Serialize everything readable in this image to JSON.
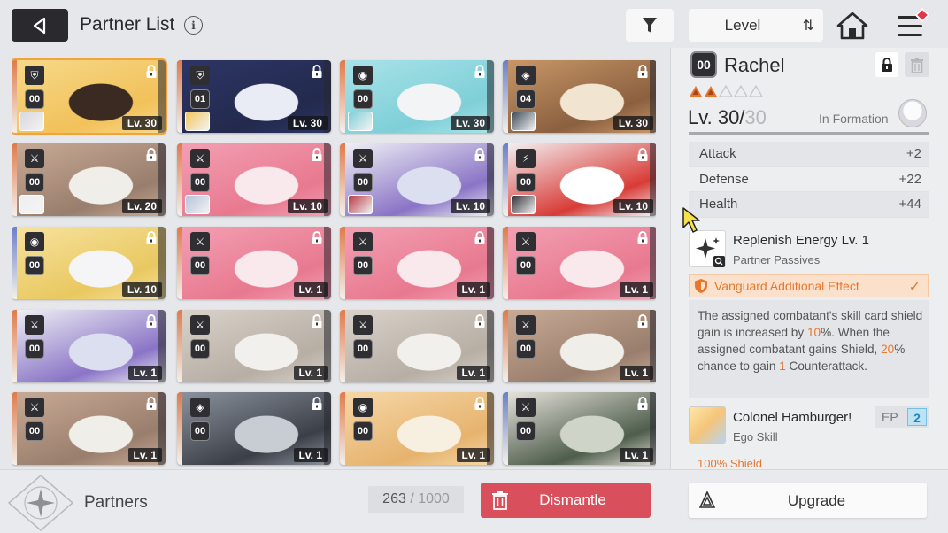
{
  "header": {
    "title": "Partner List",
    "info_icon": "i",
    "sort_label": "Level",
    "sort_order_icon": "⇅"
  },
  "icons": {
    "back": "back-arrow-icon",
    "filter": "filter-icon",
    "home": "home-icon",
    "menu": "hamburger-menu-icon",
    "lock": "lock-icon",
    "trash": "trash-icon"
  },
  "cards": [
    {
      "rank": "00",
      "class": "⛨",
      "level": "Lv. 30",
      "selected": true,
      "art": [
        "#f6d98a",
        "#f2c15a",
        "#3a2a22"
      ],
      "edge": "#e07a4a",
      "mini": "#d8d8de"
    },
    {
      "rank": "01",
      "class": "⛨",
      "level": "Lv. 30",
      "selected": false,
      "art": [
        "#2d3566",
        "#232a4d",
        "#e9ecf4"
      ],
      "edge": "#e07a4a",
      "mini": "#f2c65e"
    },
    {
      "rank": "00",
      "class": "◉",
      "level": "Lv. 30",
      "selected": false,
      "art": [
        "#a9e3e8",
        "#7fcfd8",
        "#f3f4f6"
      ],
      "edge": "#e07a4a",
      "mini": "#7fcfd8"
    },
    {
      "rank": "04",
      "class": "◈",
      "level": "Lv. 30",
      "selected": false,
      "art": [
        "#c99868",
        "#8b6040",
        "#f1e4d0"
      ],
      "edge": "#6a7fc9",
      "mini": "#3e4a58"
    },
    {
      "rank": "00",
      "class": "⚔",
      "level": "Lv. 20",
      "selected": false,
      "art": [
        "#c8ab96",
        "#9a7e6d",
        "#f0eee9"
      ],
      "edge": "#e07a4a",
      "mini": "#efeff1"
    },
    {
      "rank": "00",
      "class": "⚔",
      "level": "Lv. 10",
      "selected": false,
      "art": [
        "#f3a0b4",
        "#e8798f",
        "#f9e9ec"
      ],
      "edge": "#e07a4a",
      "mini": "#b6c3d8"
    },
    {
      "rank": "00",
      "class": "⚔",
      "level": "Lv. 10",
      "selected": false,
      "art": [
        "#f1f2f6",
        "#8a74c6",
        "#dcdff0"
      ],
      "edge": "#e07a4a",
      "mini": "#b83a44"
    },
    {
      "rank": "00",
      "class": "⚡",
      "level": "Lv. 10",
      "selected": false,
      "art": [
        "#f3f3f5",
        "#d83b36",
        "#ffffff"
      ],
      "edge": "#6a7fc9",
      "mini": "#2e2e36"
    },
    {
      "rank": "00",
      "class": "◉",
      "level": "Lv. 10",
      "selected": false,
      "art": [
        "#f7e3a0",
        "#e9c860",
        "#f5f5f7"
      ],
      "edge": "#6a7fc9",
      "mini": null
    },
    {
      "rank": "00",
      "class": "⚔",
      "level": "Lv. 1",
      "selected": false,
      "art": [
        "#f3a0b4",
        "#e8798f",
        "#f9e9ec"
      ],
      "edge": "#e07a4a",
      "mini": null
    },
    {
      "rank": "00",
      "class": "⚔",
      "level": "Lv. 1",
      "selected": false,
      "art": [
        "#f3a0b4",
        "#e8798f",
        "#f9e9ec"
      ],
      "edge": "#e07a4a",
      "mini": null
    },
    {
      "rank": "00",
      "class": "⚔",
      "level": "Lv. 1",
      "selected": false,
      "art": [
        "#f3a0b4",
        "#e8798f",
        "#f9e9ec"
      ],
      "edge": "#e07a4a",
      "mini": null
    },
    {
      "rank": "00",
      "class": "⚔",
      "level": "Lv. 1",
      "selected": false,
      "art": [
        "#f1f2f6",
        "#8a74c6",
        "#dcdff0"
      ],
      "edge": "#e07a4a",
      "mini": null
    },
    {
      "rank": "00",
      "class": "⚔",
      "level": "Lv. 1",
      "selected": false,
      "art": [
        "#d9d3cb",
        "#b7aea4",
        "#f2f0ed"
      ],
      "edge": "#e07a4a",
      "mini": null
    },
    {
      "rank": "00",
      "class": "⚔",
      "level": "Lv. 1",
      "selected": false,
      "art": [
        "#d9d3cb",
        "#b7aea4",
        "#f2f0ed"
      ],
      "edge": "#e07a4a",
      "mini": null
    },
    {
      "rank": "00",
      "class": "⚔",
      "level": "Lv. 1",
      "selected": false,
      "art": [
        "#c8ab96",
        "#9a7e6d",
        "#f0eee9"
      ],
      "edge": "#e07a4a",
      "mini": null
    },
    {
      "rank": "00",
      "class": "⚔",
      "level": "Lv. 1",
      "selected": false,
      "art": [
        "#c8ab96",
        "#9a7e6d",
        "#f0eee9"
      ],
      "edge": "#e07a4a",
      "mini": null
    },
    {
      "rank": "00",
      "class": "◈",
      "level": "Lv. 1",
      "selected": false,
      "art": [
        "#8d949e",
        "#3b3f48",
        "#c8ccd3"
      ],
      "edge": "#e07a4a",
      "mini": null
    },
    {
      "rank": "00",
      "class": "◉",
      "level": "Lv. 1",
      "selected": false,
      "art": [
        "#f6d8a8",
        "#e6b36e",
        "#f7f0e0"
      ],
      "edge": "#e07a4a",
      "mini": null
    },
    {
      "rank": "00",
      "class": "⚔",
      "level": "Lv. 1",
      "selected": false,
      "art": [
        "#e8e4dc",
        "#4e5d4c",
        "#cfd4c8"
      ],
      "edge": "#6a7fc9",
      "mini": null
    }
  ],
  "detail": {
    "rank": "00",
    "name": "Rachel",
    "stars_total": 5,
    "stars_filled": 2,
    "star_color": "#e8772e",
    "level_current": "Lv. 30/",
    "level_max": "30",
    "level_progress": 1.0,
    "in_formation_label": "In Formation",
    "stats": [
      {
        "label": "Attack",
        "value": "+2"
      },
      {
        "label": "Defense",
        "value": "+22"
      },
      {
        "label": "Health",
        "value": "+44"
      }
    ],
    "passive": {
      "title": "Replenish Energy Lv. 1",
      "subtitle": "Partner Passives"
    },
    "effect": {
      "title": "Vanguard Additional Effect",
      "check": "✓",
      "desc_parts": [
        {
          "text": "The assigned combatant's skill card shield gain is increased by ",
          "hl": false
        },
        {
          "text": "10",
          "hl": true
        },
        {
          "text": "%. When the assigned combatant gains Shield, ",
          "hl": false
        },
        {
          "text": "20",
          "hl": true
        },
        {
          "text": "% chance to gain ",
          "hl": false
        },
        {
          "text": "1",
          "hl": true
        },
        {
          "text": " Counterattack.",
          "hl": false
        }
      ]
    },
    "ego": {
      "title": "Colonel Hamburger!",
      "subtitle": "Ego Skill",
      "ep_label": "EP",
      "ep_value": "2",
      "cut_text": "100% Shield"
    }
  },
  "footer": {
    "section_label": "Partners",
    "count": "263",
    "count_sep": "/",
    "count_max": "1000",
    "dismantle_label": "Dismantle",
    "upgrade_label": "Upgrade"
  },
  "colors": {
    "accent_orange": "#e8772e",
    "dismantle_red": "#d9505c",
    "selected_outline": "#f2a33a",
    "ep_blue": "#1b86c6"
  }
}
